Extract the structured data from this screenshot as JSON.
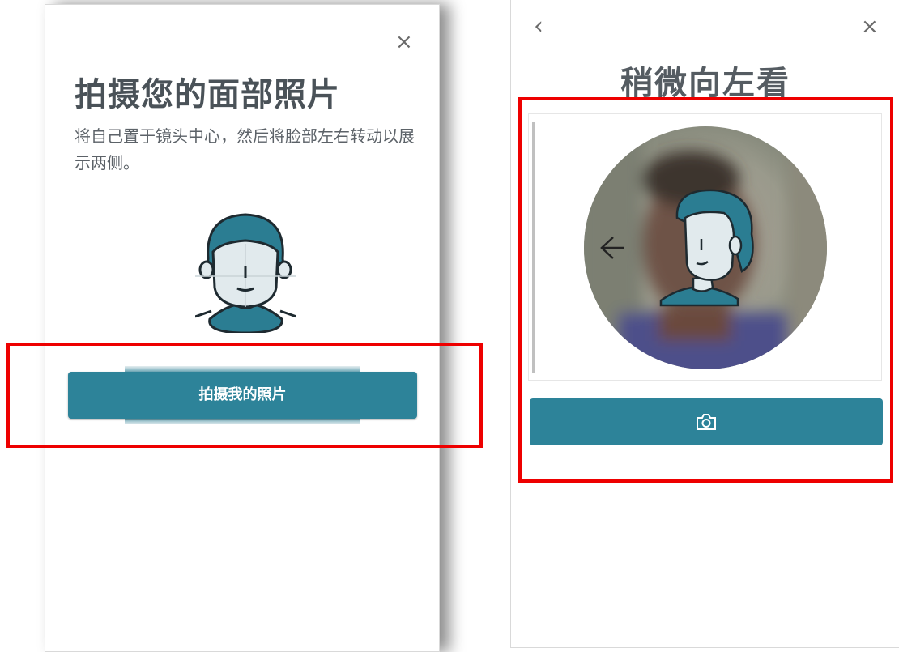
{
  "left_screen": {
    "close_glyph": "×",
    "title": "拍摄您的面部照片",
    "description": "将自己置于镜头中心，然后将脸部左右转动以展示两侧。",
    "capture_button_label": "拍摄我的照片"
  },
  "right_screen": {
    "back_glyph": "‹",
    "close_glyph": "×",
    "title": "稍微向左看",
    "direction_arrow": "←",
    "camera_button_icon": "camera-icon"
  },
  "colors": {
    "accent": "#2d8399",
    "avatar_teal": "#2b7d92",
    "face_fill": "#e1eaed",
    "highlight": "#ee0000",
    "title_text": "#4a5258"
  }
}
